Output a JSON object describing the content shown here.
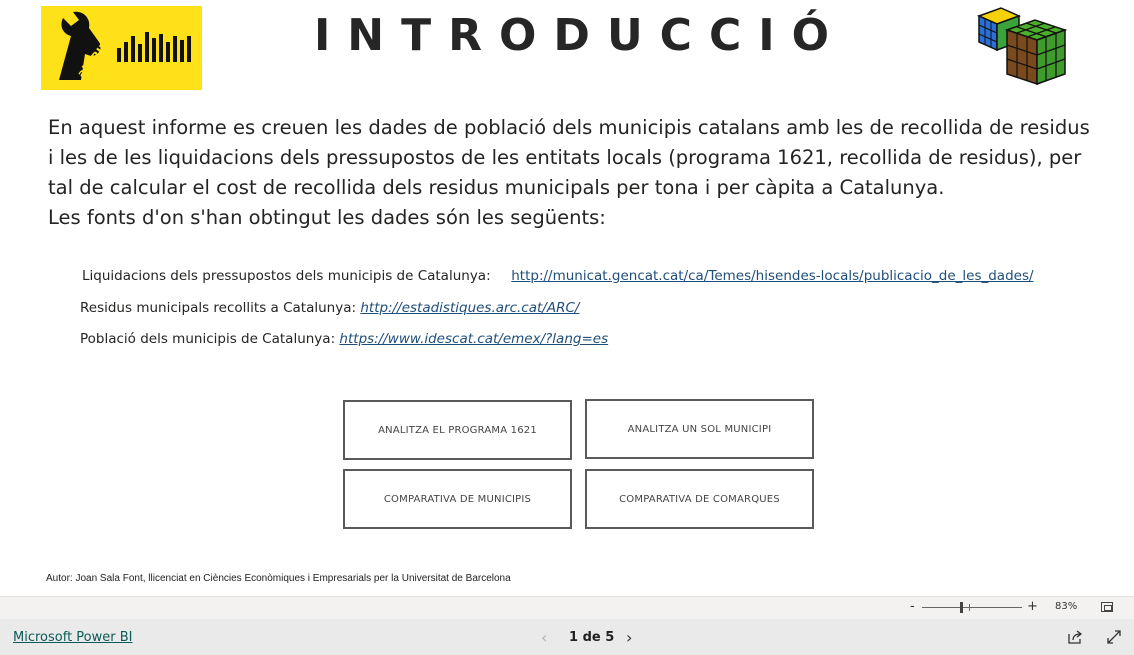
{
  "report": {
    "title": "INTRODUCCIÓ",
    "logo_alt": "aLaBIP",
    "intro_paragraph": [
      "En aquest informe es creuen les dades de  població dels municipis catalans amb les de recollida de residus",
      "i les de les liquidacions dels pressupostos de les entitats locals (programa  1621, recollida de residus), per",
      "tal de calcular el cost de recollida dels residus municipals per tona i per càpita a Catalunya.",
      "Les fonts d'on s'han obtingut les dades són les següents:"
    ],
    "sources": [
      {
        "label": "Liquidacions dels pressupostos dels municipis de Catalunya:",
        "url": "http://municat.gencat.cat/ca/Temes/hisendes-locals/publicacio_de_les_dades/"
      },
      {
        "label": "Residus municipals recollits a Catalunya:",
        "url": "http://estadistiques.arc.cat/ARC/"
      },
      {
        "label": "Població dels municipis de Catalunya:",
        "url": "https://www.idescat.cat/emex/?lang=es"
      }
    ],
    "buttons": [
      "ANALITZA EL PROGRAMA 1621",
      "ANALITZA UN SOL MUNICIPI",
      "COMPARATIVA DE MUNICIPIS",
      "COMPARATIVA DE COMARQUES"
    ],
    "author": "Autor: Joan Sala Font, llicenciat en Ciències Econòmiques i Empresarials per la Universitat de Barcelona"
  },
  "zoom": {
    "minus": "-",
    "plus": "+",
    "level": "83%"
  },
  "footer": {
    "brand": "Microsoft Power BI",
    "page_indicator": "1 de 5",
    "prev": "‹",
    "next": "›"
  },
  "colors": {
    "logo_bg": "#ffe11a",
    "link": "#1f4e79",
    "brand_link": "#0b5a57"
  }
}
